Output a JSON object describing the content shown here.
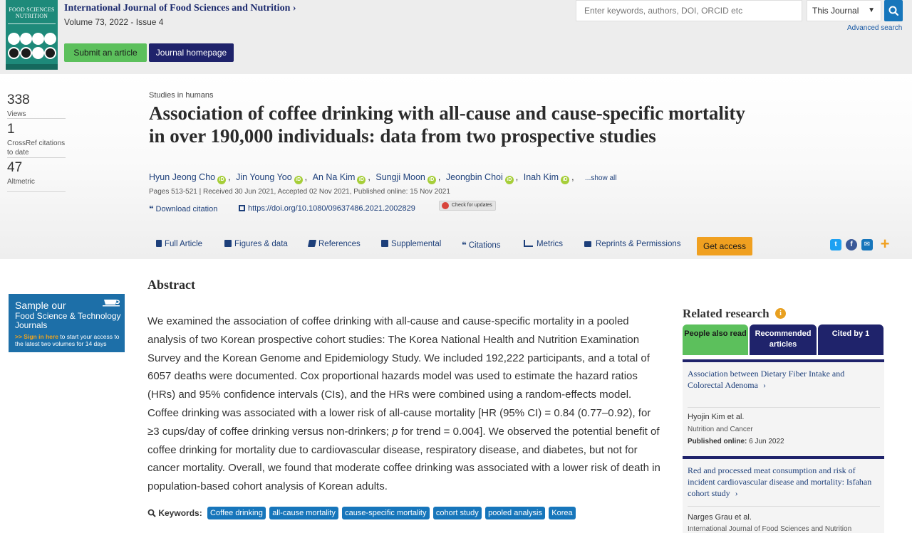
{
  "journal": {
    "title": "International Journal of Food Sciences and Nutrition",
    "title_chevron": "›",
    "volume": "Volume 73, 2022 - Issue 4",
    "cover_title": "FOOD SCIENCES NUTRITION",
    "submit_label": "Submit an article",
    "homepage_label": "Journal homepage"
  },
  "search": {
    "placeholder": "Enter keywords, authors, DOI, ORCID etc",
    "scope": "This Journal",
    "advanced": "Advanced search"
  },
  "metrics": [
    {
      "value": "338",
      "label": "Views"
    },
    {
      "value": "1",
      "label": "CrossRef citations to date"
    },
    {
      "value": "47",
      "label": "Altmetric"
    }
  ],
  "article": {
    "section": "Studies in humans",
    "title": "Association of coffee drinking with all-cause and cause-specific mortality in over 190,000 individuals: data from two prospective studies",
    "authors": [
      "Hyun Jeong Cho",
      "Jin Young Yoo",
      "An Na Kim",
      "Sungji Moon",
      "Jeongbin Choi",
      "Inah Kim"
    ],
    "show_all": "...show all",
    "pub_info": "Pages 513-521 | Received 30 Jun 2021, Accepted 02 Nov 2021, Published online: 15 Nov 2021",
    "download_citation": "Download citation",
    "doi": "https://doi.org/10.1080/09637486.2021.2002829",
    "check_updates": "Check for updates"
  },
  "tabs": [
    {
      "label": "Full Article",
      "icon": "document-icon"
    },
    {
      "label": "Figures & data",
      "icon": "image-icon"
    },
    {
      "label": "References",
      "icon": "book-icon"
    },
    {
      "label": "Supplemental",
      "icon": "plus-square-icon"
    },
    {
      "label": "Citations",
      "icon": "quote-icon"
    },
    {
      "label": "Metrics",
      "icon": "bar-chart-icon"
    },
    {
      "label": "Reprints & Permissions",
      "icon": "printer-icon"
    }
  ],
  "get_access": "Get access",
  "share": [
    {
      "icon": "twitter-icon",
      "color": "#1da1f2"
    },
    {
      "icon": "facebook-icon",
      "color": "#3b5998"
    },
    {
      "icon": "email-icon",
      "color": "#1776bb"
    },
    {
      "icon": "plus-icon",
      "color": "#f0a020"
    }
  ],
  "promo": {
    "line1": "Sample our",
    "line2": "Food Science & Technology Journals",
    "highlight": ">> Sign in here",
    "rest": " to start your access to the latest two volumes for 14 days"
  },
  "abstract": {
    "heading": "Abstract",
    "text_before": "We examined the association of coffee drinking with all-cause and cause-specific mortality in a pooled analysis of two Korean prospective cohort studies: The Korea National Health and Nutrition Examination Survey and the Korean Genome and Epidemiology Study. We included 192,222 participants, and a total of 6057 deaths were documented. Cox proportional hazards model was used to estimate the hazard ratios (HRs) and 95% confidence intervals (CIs), and the HRs were combined using a random-effects model. Coffee drinking was associated with a lower risk of all-cause mortality [HR (95% CI) = 0.84 (0.77–0.92), for ≥3 cups/day of coffee drinking versus non-drinkers; ",
    "italic": "p",
    "text_after": " for trend = 0.004]. We observed the potential benefit of coffee drinking for mortality due to cardiovascular disease, respiratory disease, and diabetes, but not for cancer mortality. Overall, we found that moderate coffee drinking was associated with a lower risk of death in population-based cohort analysis of Korean adults."
  },
  "keywords": {
    "label": "Keywords:",
    "items": [
      "Coffee drinking",
      "all-cause mortality",
      "cause-specific mortality",
      "cohort study",
      "pooled analysis",
      "Korea"
    ]
  },
  "related": {
    "heading": "Related research",
    "tabs": [
      "People also read",
      "Recommended articles",
      "Cited by 1"
    ],
    "items": [
      {
        "title": "Association between Dietary Fiber Intake and Colorectal Adenoma",
        "authors": "Hyojin Kim et al.",
        "journal": "Nutrition and Cancer",
        "published_label": "Published online:",
        "published_date": " 6 Jun 2022"
      },
      {
        "title": "Red and processed meat consumption and risk of incident cardiovascular disease and mortality: Isfahan cohort study",
        "authors": "Narges Grau et al.",
        "journal": "International Journal of Food Sciences and Nutrition"
      }
    ]
  }
}
